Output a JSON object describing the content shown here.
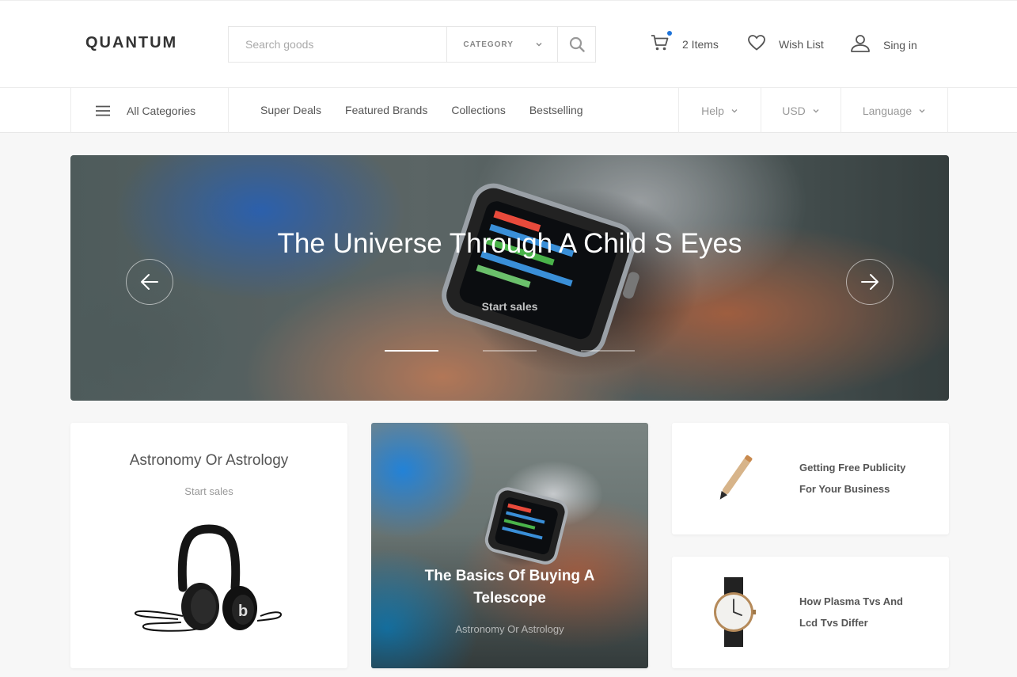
{
  "header": {
    "logo": "QUANTUM",
    "search": {
      "placeholder": "Search goods",
      "value": ""
    },
    "category_label": "CATEGORY",
    "cart_label": "2 Items",
    "wishlist_label": "Wish List",
    "signin_label": "Sing in"
  },
  "nav": {
    "all_categories": "All Categories",
    "links": [
      "Super Deals",
      "Featured Brands",
      "Collections",
      "Bestselling"
    ],
    "help": "Help",
    "currency": "USD",
    "language": "Language"
  },
  "hero": {
    "title": "The Universe Through A Child S Eyes",
    "subtitle": "Start sales",
    "slide_count": 3,
    "active_slide": 1
  },
  "cards": {
    "card1": {
      "title": "Astronomy Or Astrology",
      "subtitle": "Start sales"
    },
    "card2": {
      "title": "The Basics Of Buying A Telescope",
      "subtitle": "Astronomy Or Astrology"
    },
    "card3": {
      "line1": "Getting Free Publicity",
      "line2": "For Your Business"
    },
    "card4": {
      "line1": "How Plasma Tvs And",
      "line2": "Lcd Tvs Differ"
    }
  },
  "colors": {
    "accent": "#1e73d8",
    "text": "#333333",
    "muted": "#999999",
    "background": "#f7f7f7"
  },
  "icons": [
    "cart-icon",
    "heart-icon",
    "user-icon",
    "search-icon",
    "menu-icon",
    "chevron-down-icon",
    "arrow-left-icon",
    "arrow-right-icon"
  ]
}
